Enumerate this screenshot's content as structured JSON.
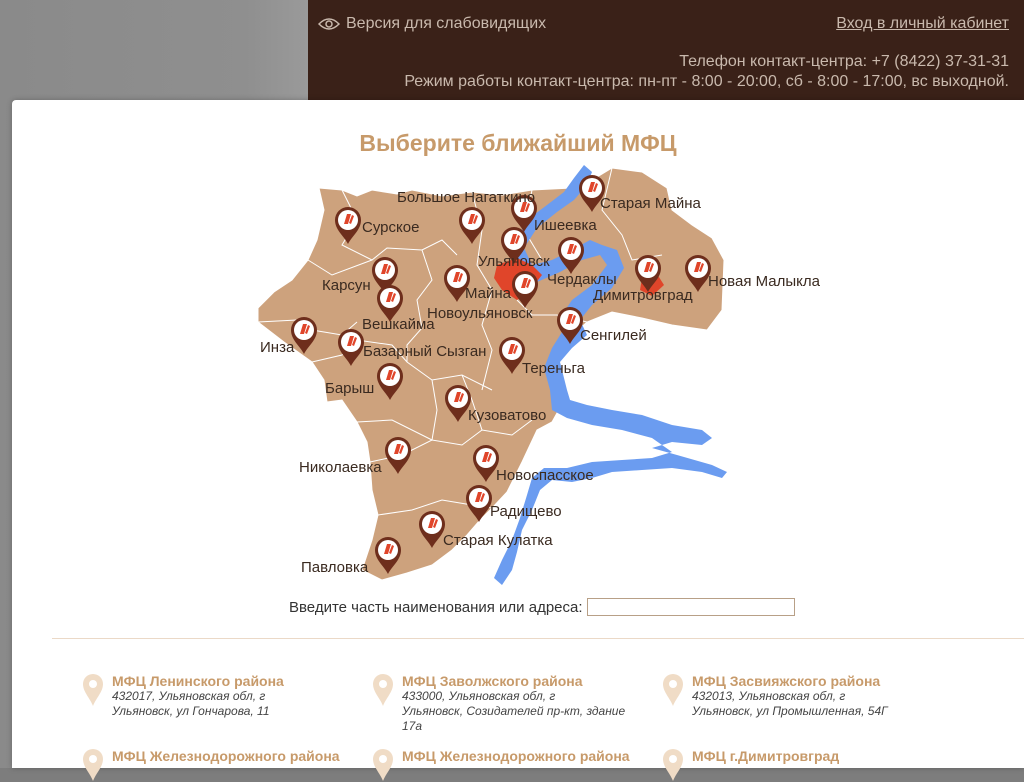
{
  "header": {
    "vision_label": "Версия для слабовидящих",
    "cabinet_label": "Вход в личный кабинет",
    "phone": "Телефон контакт-центра: +7 (8422) 37-31-31",
    "hours": "Режим работы контакт-центра: пн-пт - 8:00 - 20:00, сб - 8:00 - 17:00, вс выходной."
  },
  "modal": {
    "title": "Выберите ближайший МФЦ",
    "search_label": "Введите часть наименования или адреса:",
    "search_value": "",
    "search_placeholder": ""
  },
  "map": {
    "cities": [
      {
        "name": "Сурское"
      },
      {
        "name": "Большое Нагаткино"
      },
      {
        "name": "Ишеевка"
      },
      {
        "name": "Старая Майна"
      },
      {
        "name": "Ульяновск"
      },
      {
        "name": "Чердаклы"
      },
      {
        "name": "Новая Малыкла"
      },
      {
        "name": "Димитровград"
      },
      {
        "name": "Карсун"
      },
      {
        "name": "Майна"
      },
      {
        "name": "Вешкайма"
      },
      {
        "name": "Новоульяновск"
      },
      {
        "name": "Сенгилей"
      },
      {
        "name": "Инза"
      },
      {
        "name": "Базарный Сызган"
      },
      {
        "name": "Тереньга"
      },
      {
        "name": "Барыш"
      },
      {
        "name": "Кузоватово"
      },
      {
        "name": "Николаевка"
      },
      {
        "name": "Новоспасское"
      },
      {
        "name": "Радищево"
      },
      {
        "name": "Старая Кулатка"
      },
      {
        "name": "Павловка"
      }
    ]
  },
  "offices": [
    {
      "name": "МФЦ Ленинского района",
      "addr1": "432017, Ульяновская обл, г",
      "addr2": "Ульяновск, ул Гончарова, 11",
      "addr3": ""
    },
    {
      "name": "МФЦ Заволжского района",
      "addr1": "433000, Ульяновская обл, г",
      "addr2": "Ульяновск, Созидателей пр-кт, здание",
      "addr3": "17а"
    },
    {
      "name": "МФЦ Засвияжского района",
      "addr1": "432013, Ульяновская обл, г",
      "addr2": "Ульяновск, ул Промышленная, 54Г",
      "addr3": ""
    },
    {
      "name": "МФЦ Железнодорожного района",
      "addr1": "",
      "addr2": "",
      "addr3": ""
    },
    {
      "name": "МФЦ Железнодорожного района",
      "addr1": "",
      "addr2": "",
      "addr3": ""
    },
    {
      "name": "МФЦ г.Димитровград",
      "addr1": "",
      "addr2": "",
      "addr3": ""
    }
  ],
  "colors": {
    "header_bg": "#3a2118",
    "accent": "#c79a6a",
    "region_fill": "#cda27d",
    "water": "#6b9cf0",
    "city_highlight": "#e0452a",
    "pin": "#6e2e1c"
  }
}
